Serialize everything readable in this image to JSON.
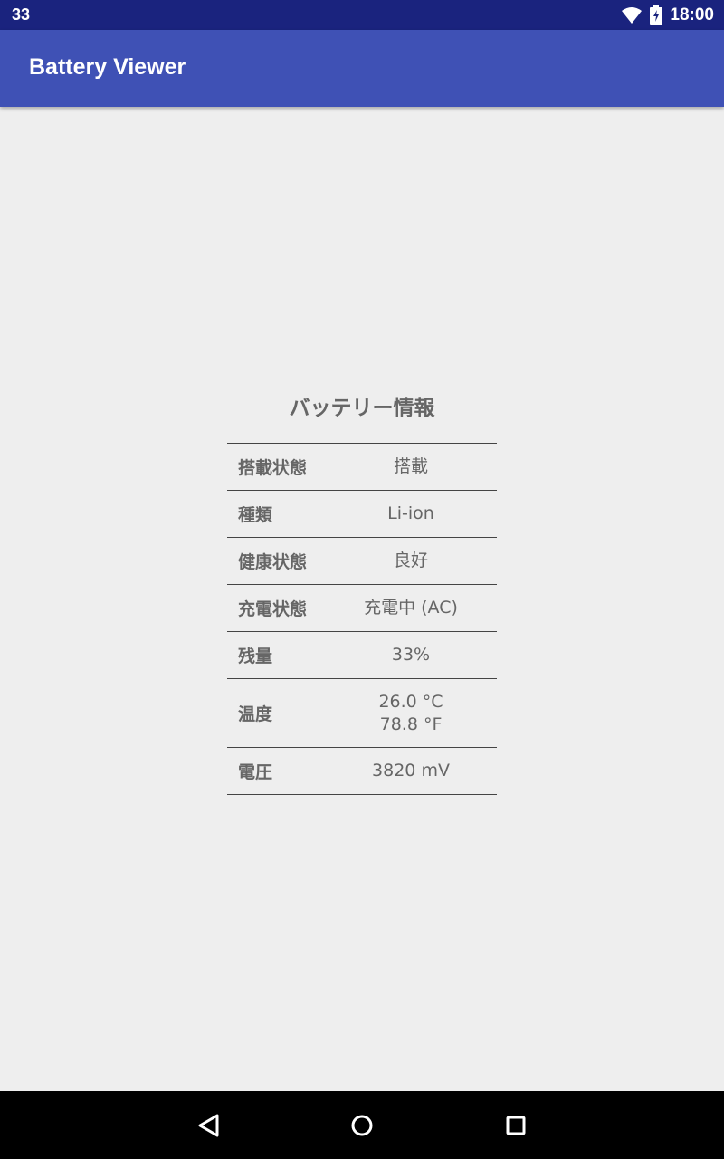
{
  "status_bar": {
    "notification_count": "33",
    "time": "18:00",
    "icons": [
      "wifi-icon",
      "battery-icon"
    ]
  },
  "app_bar": {
    "title": "Battery Viewer"
  },
  "battery_info": {
    "heading": "バッテリー情報",
    "rows": [
      {
        "label": "搭載状態",
        "values": [
          "搭載"
        ]
      },
      {
        "label": "種類",
        "values": [
          "Li-ion"
        ]
      },
      {
        "label": "健康状態",
        "values": [
          "良好"
        ]
      },
      {
        "label": "充電状態",
        "values": [
          "充電中 (AC)"
        ]
      },
      {
        "label": "残量",
        "values": [
          "33%"
        ]
      },
      {
        "label": "温度",
        "values": [
          "26.0 °C",
          "78.8 °F"
        ]
      },
      {
        "label": "電圧",
        "values": [
          "3820 mV"
        ]
      }
    ]
  },
  "nav_bar": {
    "icons": [
      "back-icon",
      "home-icon",
      "recents-icon"
    ]
  },
  "colors": {
    "status_bar": "#1a237e",
    "app_bar": "#3f51b5",
    "background": "#eeeeee",
    "text": "#666666"
  }
}
